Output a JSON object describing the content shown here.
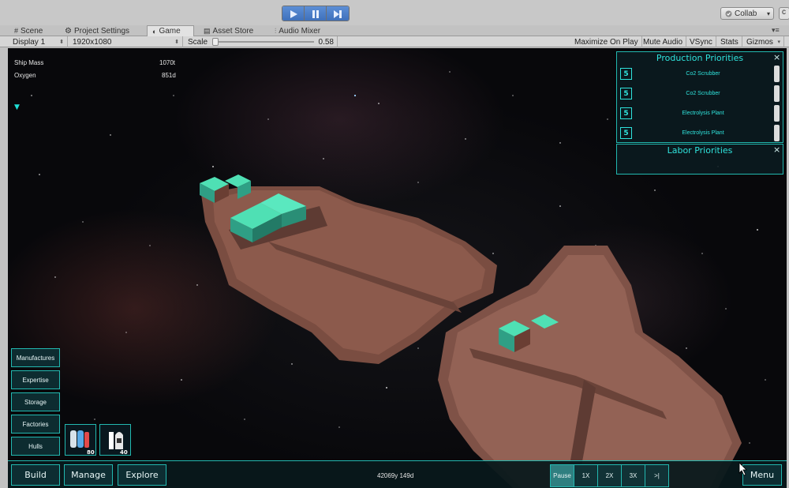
{
  "toolbar": {
    "play_icon": "play-icon",
    "pause_icon": "pause-icon",
    "step_icon": "step-icon",
    "collab_label": "Collab",
    "collab_arrow": "▾",
    "account_label": "c"
  },
  "tabs": [
    {
      "label": "Scene",
      "icon": "hash-icon"
    },
    {
      "label": "Project Settings",
      "icon": "gear-icon"
    },
    {
      "label": "Game",
      "icon": "game-icon"
    },
    {
      "label": "Asset Store",
      "icon": "store-icon"
    },
    {
      "label": "Audio Mixer",
      "icon": "mixer-icon"
    }
  ],
  "gamebar": {
    "display": "Display 1",
    "resolution": "1920x1080",
    "scale_label": "Scale",
    "scale_value": "0.58",
    "maximize": "Maximize On Play",
    "mute": "Mute Audio",
    "vsync": "VSync",
    "stats": "Stats",
    "gizmos": "Gizmos"
  },
  "stats": [
    {
      "label": "Ship Mass",
      "value": "1070t"
    },
    {
      "label": "Oxygen",
      "value": "851d"
    }
  ],
  "production": {
    "title": "Production Priorities",
    "close": "×",
    "items": [
      {
        "priority": "5",
        "label": "Co2 Scrubber"
      },
      {
        "priority": "5",
        "label": "Co2 Scrubber"
      },
      {
        "priority": "5",
        "label": "Electrolysis Plant"
      },
      {
        "priority": "5",
        "label": "Electrolysis Plant"
      }
    ]
  },
  "labor": {
    "title": "Labor Priorities",
    "close": "×"
  },
  "side_menu": [
    "Manufactures",
    "Expertise",
    "Storage",
    "Factories",
    "Hulls"
  ],
  "module_tiles": [
    {
      "count": "80",
      "icon": "tank-icon"
    },
    {
      "count": "40",
      "icon": "rocket-icon"
    }
  ],
  "bottom": {
    "build": "Build",
    "manage": "Manage",
    "explore": "Explore",
    "date": "42069y 149d",
    "pause": "Pause",
    "speed1": "1X",
    "speed2": "2X",
    "speed3": "3X",
    "skip": ">|",
    "menu": "Menu"
  },
  "colors": {
    "accent": "#22b8b0",
    "title_teal": "#2fe3dc",
    "hull": "#8c5a4c",
    "module": "#3fc9a5"
  }
}
